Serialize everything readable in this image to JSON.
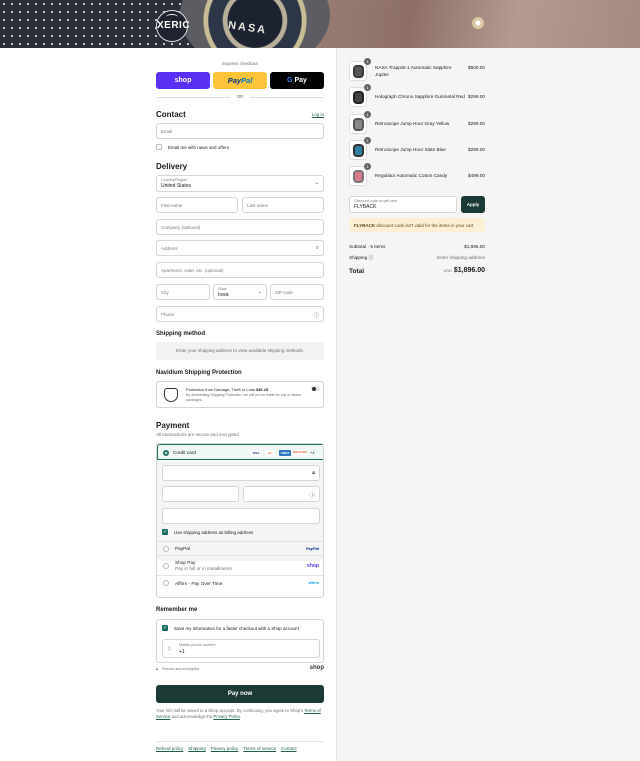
{
  "header": {
    "logo_text": "XERIC",
    "watch_text": "NASA"
  },
  "express": {
    "title": "Express checkout",
    "shop_label": "shop",
    "paypal_label_a": "Pay",
    "paypal_label_b": "Pal",
    "gpay_label": "Pay",
    "or": "OR"
  },
  "contact": {
    "heading": "Contact",
    "login": "Log in",
    "email_placeholder": "Email",
    "news_label": "Email me with news and offers"
  },
  "delivery": {
    "heading": "Delivery",
    "country_label": "Country/Region",
    "country_value": "United States",
    "first_name": "First name",
    "last_name": "Last name",
    "company": "Company (optional)",
    "address": "Address",
    "apartment": "Apartment, suite, etc. (optional)",
    "city": "City",
    "state_label": "State",
    "state_value": "Iowa",
    "zip": "ZIP code",
    "phone": "Phone"
  },
  "shipping_method": {
    "heading": "Shipping method",
    "message": "Enter your shipping address to view available shipping methods."
  },
  "protection": {
    "heading": "Navidium Shipping Protection",
    "line1": "Protection from Damage, Theft or Loss",
    "price": "$36.25",
    "line2": "By deselecting Shipping Protection, we will not be liable for lost or stolen packages."
  },
  "payment": {
    "heading": "Payment",
    "subtitle": "All transactions are secure and encrypted.",
    "credit_card": "Credit card",
    "card_logos": [
      "VISA",
      "MC",
      "AMEX",
      "DISCOVER"
    ],
    "more_cards": "+4",
    "billing_label": "Use shipping address as billing address",
    "paypal": "PayPal",
    "shop_pay": "Shop Pay",
    "shop_pay_sub": "Pay in full or in installments",
    "affirm": "Affirm - Pay Over Time",
    "shop_logo": "shop",
    "paypal_logo": "PayPal",
    "affirm_logo": "affirm"
  },
  "remember": {
    "heading": "Remember me",
    "save_label": "Save my information for a faster checkout with a Shop account",
    "mobile_label": "Mobile phone number",
    "mobile_value": "+1",
    "secure": "Secure and encrypted",
    "shop_logo": "shop"
  },
  "pay_now": "Pay now",
  "terms": {
    "text1": "Your info will be saved to a Shop account. By continuing, you agree to Shop's",
    "tos": "Terms of Service",
    "text2": "and acknowledge the",
    "privacy": "Privacy Policy",
    "end": "."
  },
  "footer": [
    "Refund policy",
    "Shipping",
    "Privacy policy",
    "Terms of service",
    "Contact"
  ],
  "cart": {
    "items": [
      {
        "qty": "1",
        "name": "NASA Trappist-1 Automatic Sapphire Jupiter",
        "price": "$500.00",
        "color": "#3a3a3a"
      },
      {
        "qty": "1",
        "name": "Holograph Chrono Sapphire Gunmetal Red",
        "price": "$299.00",
        "color": "#2a2a2a"
      },
      {
        "qty": "1",
        "name": "Retroscope Jump Hour Gray Yellow",
        "price": "$299.00",
        "color": "#6b6b6b"
      },
      {
        "qty": "1",
        "name": "Retroscope Jump Hour Slate Blue",
        "price": "$299.00",
        "color": "#2e7fa3"
      },
      {
        "qty": "1",
        "name": "Regulator Automatic Cotton Candy",
        "price": "$499.00",
        "color": "#d77a8a"
      }
    ],
    "discount_label": "Discount code or gift card",
    "discount_value": "FLYBACK",
    "apply": "Apply",
    "warning_code": "FLYBACK",
    "warning_text": "discount code isn't valid for the items in your cart",
    "subtotal_label": "Subtotal · 5 items",
    "subtotal_value": "$1,896.00",
    "shipping_label": "Shipping",
    "shipping_value": "Enter shipping address",
    "total_label": "Total",
    "currency": "USD",
    "total_value": "$1,896.00"
  }
}
